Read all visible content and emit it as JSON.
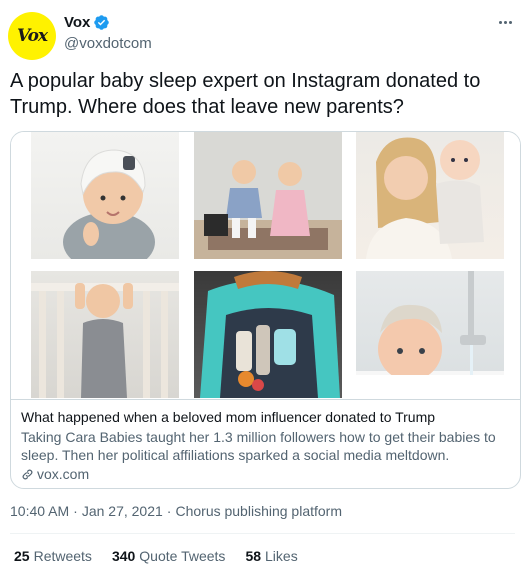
{
  "author": {
    "avatar_text": "Vox",
    "display_name": "Vox",
    "handle": "@voxdotcom",
    "verified": true,
    "avatar_color": "#fff200"
  },
  "tweet": {
    "text": "A popular baby sleep expert on Instagram donated to Trump. Where does that leave new parents?"
  },
  "card": {
    "title": "What happened when a beloved mom influencer donated to Trump",
    "description": "Taking Cara Babies taught her 1.3 million followers how to get their babies to sleep. Then her political affiliations sparked a social media meltdown.",
    "domain": "vox.com",
    "images": [
      {
        "icon": "baby-with-helmet-photo"
      },
      {
        "icon": "two-toddlers-photo"
      },
      {
        "icon": "mother-and-baby-photo"
      },
      {
        "icon": "baby-in-crib-photo"
      },
      {
        "icon": "diaper-bag-photo"
      },
      {
        "icon": "baby-bath-photo"
      }
    ]
  },
  "meta": {
    "time": "10:40 AM",
    "date": "Jan 27, 2021",
    "separator": "·",
    "source": "Chorus publishing platform"
  },
  "stats": {
    "retweets_count": "25",
    "retweets_label": "Retweets",
    "quotes_count": "340",
    "quotes_label": "Quote Tweets",
    "likes_count": "58",
    "likes_label": "Likes"
  },
  "colors": {
    "text_primary": "#0f1419",
    "text_secondary": "#536471",
    "verified_blue": "#1d9bf0",
    "border": "#cfd9de"
  }
}
